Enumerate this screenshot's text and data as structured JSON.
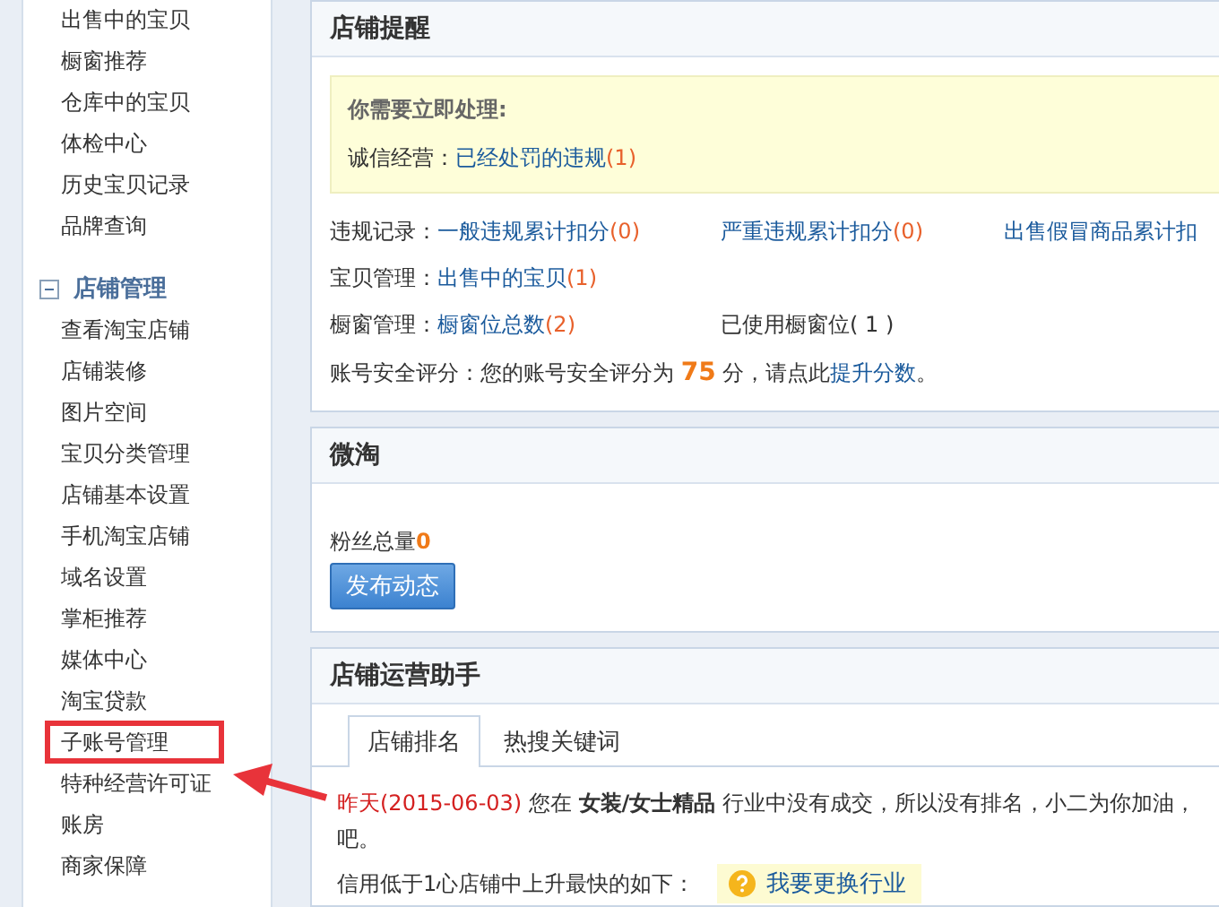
{
  "sidebar": {
    "items": [
      {
        "label": "出售中的宝贝",
        "highlighted": false
      },
      {
        "label": "橱窗推荐",
        "highlighted": false
      },
      {
        "label": "仓库中的宝贝",
        "highlighted": false
      },
      {
        "label": "体检中心",
        "highlighted": false
      },
      {
        "label": "历史宝贝记录",
        "highlighted": false
      },
      {
        "label": "品牌查询",
        "highlighted": false
      }
    ],
    "sections": [
      {
        "title": "店铺管理",
        "expanded": true,
        "items": [
          {
            "label": "查看淘宝店铺",
            "highlighted": false
          },
          {
            "label": "店铺装修",
            "highlighted": false
          },
          {
            "label": "图片空间",
            "highlighted": false
          },
          {
            "label": "宝贝分类管理",
            "highlighted": false
          },
          {
            "label": "店铺基本设置",
            "highlighted": false
          },
          {
            "label": "手机淘宝店铺",
            "highlighted": false
          },
          {
            "label": "域名设置",
            "highlighted": false
          },
          {
            "label": "掌柜推荐",
            "highlighted": false
          },
          {
            "label": "媒体中心",
            "highlighted": false
          },
          {
            "label": "淘宝贷款",
            "highlighted": false
          },
          {
            "label": "子账号管理",
            "highlighted": true
          },
          {
            "label": "特种经营许可证",
            "highlighted": false
          },
          {
            "label": "账房",
            "highlighted": false
          },
          {
            "label": "商家保障",
            "highlighted": false
          }
        ]
      }
    ]
  },
  "store_reminder": {
    "title": "店铺提醒",
    "urgent": {
      "heading": "你需要立即处理:",
      "label": "诚信经营：",
      "link": "已经处罚的违规",
      "count": "(1)"
    },
    "rows": [
      {
        "label": "违规记录：",
        "items": [
          {
            "kind": "link",
            "text": "一般违规累计扣分",
            "count": "(0)"
          },
          {
            "kind": "link",
            "text": "严重违规累计扣分",
            "count": "(0)"
          },
          {
            "kind": "link",
            "text": "出售假冒商品累计扣"
          }
        ]
      },
      {
        "label": "宝贝管理：",
        "items": [
          {
            "kind": "link",
            "text": "出售中的宝贝",
            "count": "(1)"
          }
        ]
      },
      {
        "label": "橱窗管理：",
        "items": [
          {
            "kind": "link",
            "text": "橱窗位总数",
            "count": "(2)"
          },
          {
            "kind": "text",
            "text": "已使用橱窗位( 1 )"
          }
        ]
      }
    ],
    "security": {
      "label": "账号安全评分：",
      "before": "您的账号安全评分为",
      "score": "75",
      "after": "分，请点此",
      "link": "提升分数",
      "end": "。"
    }
  },
  "weitao": {
    "title": "微淘",
    "fans_label": "粉丝总量",
    "fans_count": "0",
    "button": "发布动态"
  },
  "assistant": {
    "title": "店铺运营助手",
    "tabs": [
      {
        "label": "店铺排名",
        "selected": true
      },
      {
        "label": "热搜关键词",
        "selected": false
      }
    ],
    "notice": {
      "date": "昨天(2015-06-03)",
      "text": " 您在 **女装/女士精品** 行业中没有成交，所以没有排名，小二为你加油，",
      "continuation": "吧。"
    },
    "rise": {
      "text": "信用低于1心店铺中上升最快的如下：",
      "link": "我要更换行业"
    }
  }
}
